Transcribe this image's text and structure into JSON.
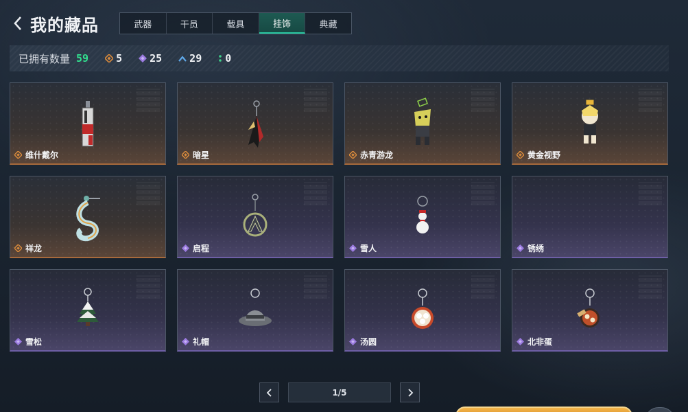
{
  "header": {
    "title": "我的藏品"
  },
  "tabs": [
    {
      "label": "武器"
    },
    {
      "label": "干员"
    },
    {
      "label": "载具"
    },
    {
      "label": "挂饰",
      "active": true
    },
    {
      "label": "典藏"
    }
  ],
  "stats": {
    "owned_label": "已拥有数量",
    "owned_total": "59",
    "rarities": [
      {
        "icon": "orange-diamond-icon",
        "color": "#d98a3c",
        "count": "5"
      },
      {
        "icon": "purple-diamond-icon",
        "color": "#9b7be0",
        "count": "25"
      },
      {
        "icon": "blue-chevron-icon",
        "color": "#5fa8e8",
        "count": "29"
      },
      {
        "icon": "green-dots-icon",
        "color": "#3fd08a",
        "count": "0"
      }
    ]
  },
  "items": [
    {
      "name": "维什戴尔",
      "rarity": "orange",
      "icon": "vial-charm-icon"
    },
    {
      "name": "暗星",
      "rarity": "orange",
      "icon": "feather-charm-icon"
    },
    {
      "name": "赤青游龙",
      "rarity": "orange",
      "icon": "dragon-figure-charm-icon"
    },
    {
      "name": "黄金视野",
      "rarity": "orange",
      "icon": "chibi-figure-charm-icon"
    },
    {
      "name": "祥龙",
      "rarity": "orange",
      "icon": "coiled-dragon-charm-icon"
    },
    {
      "name": "启程",
      "rarity": "purple",
      "icon": "emblem-charm-icon"
    },
    {
      "name": "雪人",
      "rarity": "purple",
      "icon": "snowman-charm-icon"
    },
    {
      "name": "锈绣",
      "rarity": "purple",
      "icon": ""
    },
    {
      "name": "雪松",
      "rarity": "purple",
      "icon": "snowy-tree-charm-icon"
    },
    {
      "name": "礼帽",
      "rarity": "purple",
      "icon": "hat-charm-icon"
    },
    {
      "name": "汤圆",
      "rarity": "purple",
      "icon": "dumpling-bowl-charm-icon"
    },
    {
      "name": "北非蛋",
      "rarity": "purple",
      "icon": "shakshuka-pan-charm-icon"
    }
  ],
  "pagination": {
    "label": "1/5"
  },
  "colors": {
    "accent": "#29c9a2",
    "orange_rarity": "#d98a3c",
    "purple_rarity": "#9b7be0",
    "total_green": "#32e08f"
  }
}
